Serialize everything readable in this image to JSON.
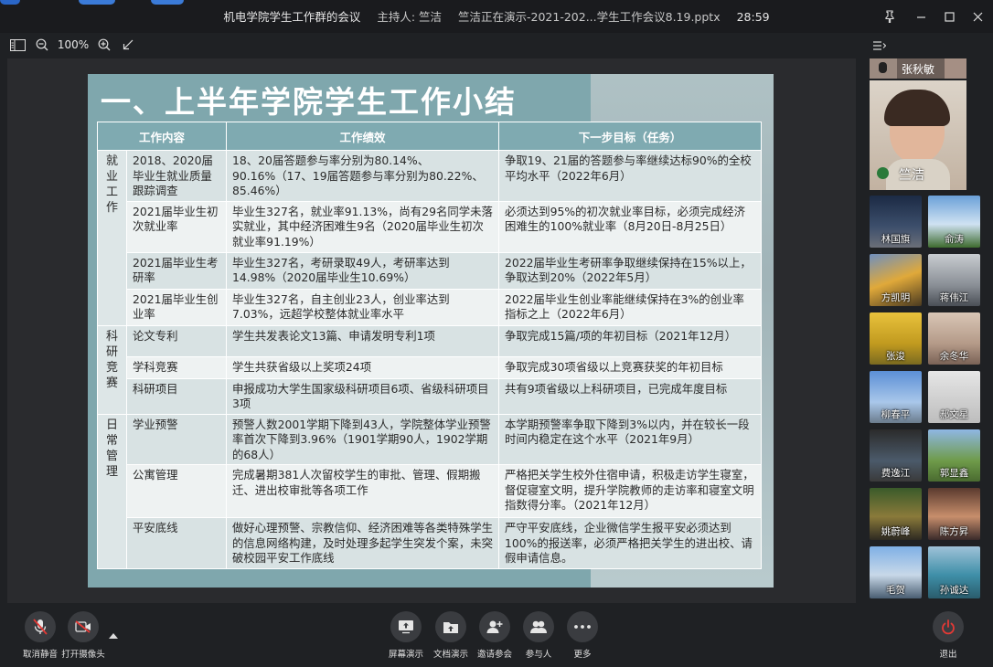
{
  "window": {
    "title": "机电学院学生工作群的会议",
    "host": "主持人: 竺洁",
    "sharing": "竺洁正在演示-2021-202...学生工作会议8.19.pptx",
    "elapsed": "28:59"
  },
  "toolbar": {
    "zoom": "100%"
  },
  "slide": {
    "heading": "一、上半年学院学生工作小结",
    "headers": [
      "工作内容",
      "工作绩效",
      "下一步目标（任务）"
    ],
    "groups": [
      {
        "category": "就业工作",
        "rows": [
          {
            "item": "2018、2020届毕业生就业质量跟踪调查",
            "result": "18、20届答题参与率分别为80.14%、90.16%（17、19届答题参与率分别为80.22%、85.46%）",
            "goal": "争取19、21届的答题参与率继续达标90%的全校平均水平（2022年6月）"
          },
          {
            "item": "2021届毕业生初次就业率",
            "result": "毕业生327名，就业率91.13%，尚有29名同学未落实就业，其中经济困难生9名（2020届毕业生初次就业率91.19%）",
            "goal": "必须达到95%的初次就业率目标，必须完成经济困难生的100%就业率（8月20日-8月25日）"
          },
          {
            "item": "2021届毕业生考研率",
            "result": "毕业生327名，考研录取49人，考研率达到14.98%（2020届毕业生10.69%）",
            "goal": "2022届毕业生考研率争取继续保持在15%以上，争取达到20%（2022年5月）"
          },
          {
            "item": "2021届毕业生创业率",
            "result": "毕业生327名，自主创业23人，创业率达到7.03%，远超学校整体就业率水平",
            "goal": "2022届毕业生创业率能继续保持在3%的创业率指标之上（2022年6月）"
          }
        ]
      },
      {
        "category": "科研竞赛",
        "rows": [
          {
            "item": "论文专利",
            "result": "学生共发表论文13篇、申请发明专利1项",
            "goal": "争取完成15篇/项的年初目标（2021年12月）"
          },
          {
            "item": "学科竞赛",
            "result": "学生共获省级以上奖项24项",
            "goal": "争取完成30项省级以上竞赛获奖的年初目标"
          },
          {
            "item": "科研项目",
            "result": "申报成功大学生国家级科研项目6项、省级科研项目3项",
            "goal": "共有9项省级以上科研项目，已完成年度目标"
          }
        ]
      },
      {
        "category": "日常管理",
        "rows": [
          {
            "item": "学业预警",
            "result": "预警人数2001学期下降到43人，学院整体学业预警率首次下降到3.96%（1901学期90人，1902学期的68人）",
            "goal": "本学期预警率争取下降到3%以内，并在较长一段时间内稳定在这个水平（2021年9月）"
          },
          {
            "item": "公寓管理",
            "result": "完成暑期381人次留校学生的审批、管理、假期搬迁、进出校审批等各项工作",
            "goal": "严格把关学生校外住宿申请，积极走访学生寝室，督促寝室文明，提升学院教师的走访率和寝室文明指数得分率。（2021年12月）"
          },
          {
            "item": "平安底线",
            "result": "做好心理预警、宗教信仰、经济困难等各类特殊学生的信息网络构建，及时处理多起学生突发个案，未突破校园平安工作底线",
            "goal": "严守平安底线，企业微信学生报平安必须达到100%的报送率，必须严格把关学生的进出校、请假申请信息。"
          }
        ]
      }
    ]
  },
  "participants": {
    "speaker_top": "张秋敏",
    "active": "竺洁",
    "tiles": [
      "林国旗",
      "俞涛",
      "方凯明",
      "蒋伟江",
      "张浚",
      "余冬华",
      "柳春平",
      "郝文星",
      "费逸江",
      "郭显鑫",
      "姚蔚峰",
      "陈方昇",
      "毛贺",
      "孙诚达"
    ]
  },
  "bottom": {
    "mute": "取消静音",
    "camera": "打开摄像头",
    "screen": "屏幕演示",
    "doc": "文档演示",
    "invite": "邀请参会",
    "members": "参与人",
    "more": "更多",
    "leave": "退出"
  },
  "colors": {
    "leave": "#e53935",
    "slide_bg": "#7fa7ad",
    "header": "#7faab1"
  }
}
